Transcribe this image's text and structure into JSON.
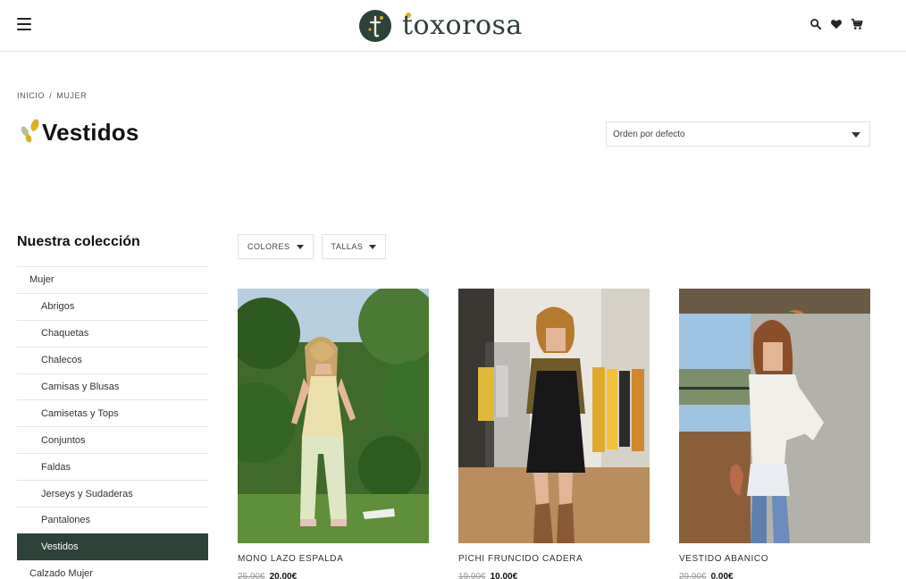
{
  "brand": {
    "name": "toxorosa"
  },
  "header": {
    "icons": [
      "menu-icon",
      "search-icon",
      "heart-icon",
      "cart-icon"
    ]
  },
  "breadcrumb": {
    "items": [
      "INICIO",
      "MUJER"
    ],
    "separator": "/"
  },
  "page": {
    "title": "Vestidos"
  },
  "sort": {
    "selected": "Orden por defecto"
  },
  "sidebar": {
    "title": "Nuestra colección",
    "items": [
      {
        "label": "Mujer",
        "level": 0
      },
      {
        "label": "Abrigos",
        "level": 1
      },
      {
        "label": "Chaquetas",
        "level": 1
      },
      {
        "label": "Chalecos",
        "level": 1
      },
      {
        "label": "Camisas y Blusas",
        "level": 1
      },
      {
        "label": "Camisetas y Tops",
        "level": 1
      },
      {
        "label": "Conjuntos",
        "level": 1
      },
      {
        "label": "Faldas",
        "level": 1
      },
      {
        "label": "Jerseys y Sudaderas",
        "level": 1
      },
      {
        "label": "Pantalones",
        "level": 1
      },
      {
        "label": "Vestidos",
        "level": 1,
        "active": true
      },
      {
        "label": "Calzado Mujer",
        "level": 0
      }
    ]
  },
  "filters": [
    {
      "label": "COLORES"
    },
    {
      "label": "TALLAS"
    }
  ],
  "products": [
    {
      "name": "MONO LAZO ESPALDA",
      "old_price": "25,90€",
      "price": "20,00€"
    },
    {
      "name": "PICHI FRUNCIDO CADERA",
      "old_price": "19,90€",
      "price": "10,00€"
    },
    {
      "name": "VESTIDO ABANICO",
      "old_price": "29,90€",
      "price": "0,00€"
    }
  ],
  "colors": {
    "brand_green": "#2d4238",
    "accent_yellow": "#d9b21c"
  }
}
